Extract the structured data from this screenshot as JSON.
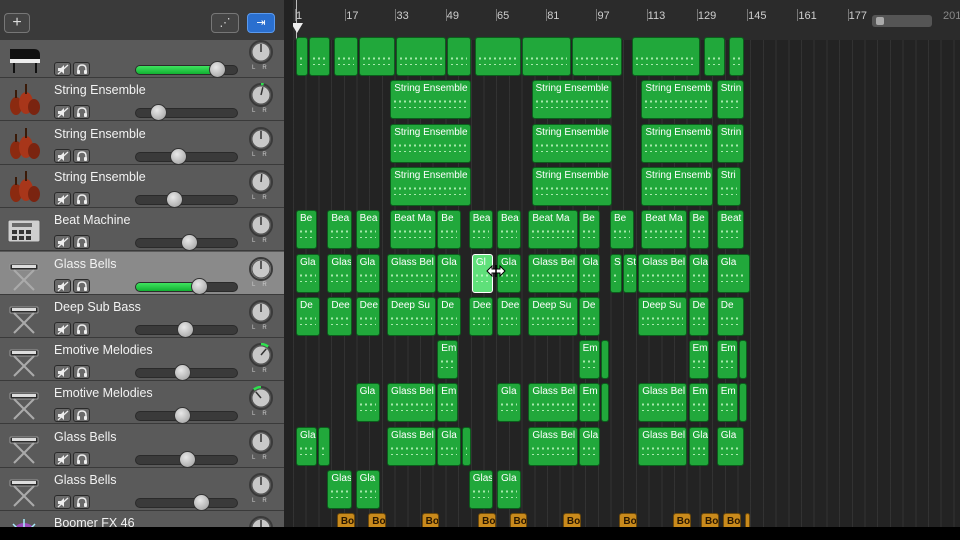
{
  "toolbar": {
    "add_track_label": "+",
    "automation_label": "⋰",
    "catch_label": "⇥"
  },
  "ruler": {
    "bars": [
      "1",
      "17",
      "33",
      "49",
      "65",
      "81",
      "97",
      "113",
      "129",
      "145",
      "161",
      "177"
    ],
    "right_partial": "201"
  },
  "tracks": [
    {
      "name": "",
      "icon": "grand-piano-icon",
      "volume": 0.8,
      "pan": 0.5,
      "green_volume": true,
      "selected": false
    },
    {
      "name": "String Ensemble",
      "icon": "string-ensemble-icon",
      "volume": 0.22,
      "pan": 0.55,
      "green_volume": false,
      "selected": false
    },
    {
      "name": "String Ensemble",
      "icon": "string-ensemble-icon",
      "volume": 0.42,
      "pan": 0.5,
      "green_volume": false,
      "selected": false
    },
    {
      "name": "String Ensemble",
      "icon": "string-ensemble-icon",
      "volume": 0.38,
      "pan": 0.52,
      "green_volume": false,
      "selected": false
    },
    {
      "name": "Beat Machine",
      "icon": "drum-machine-icon",
      "volume": 0.52,
      "pan": 0.5,
      "green_volume": false,
      "selected": false
    },
    {
      "name": "Glass Bells",
      "icon": "keyboard-stand-icon",
      "volume": 0.62,
      "pan": 0.5,
      "green_volume": true,
      "selected": true
    },
    {
      "name": "Deep Sub Bass",
      "icon": "keyboard-stand-icon",
      "volume": 0.49,
      "pan": 0.5,
      "green_volume": false,
      "selected": false
    },
    {
      "name": "Emotive Melodies",
      "icon": "keyboard-stand-icon",
      "volume": 0.46,
      "pan": 0.65,
      "green_volume": false,
      "selected": false
    },
    {
      "name": "Emotive Melodies",
      "icon": "keyboard-stand-icon",
      "volume": 0.46,
      "pan": 0.35,
      "green_volume": false,
      "selected": false
    },
    {
      "name": "Glass Bells",
      "icon": "keyboard-stand-icon",
      "volume": 0.5,
      "pan": 0.5,
      "green_volume": false,
      "selected": false
    },
    {
      "name": "Glass Bells",
      "icon": "keyboard-stand-icon",
      "volume": 0.64,
      "pan": 0.5,
      "green_volume": false,
      "selected": false
    },
    {
      "name": "Boomer FX 46",
      "icon": "fx-sparkle-icon",
      "volume": 0.35,
      "pan": 0.5,
      "green_volume": false,
      "selected": false
    }
  ],
  "regions": [
    [
      {
        "label": "",
        "s": 1,
        "e": 5,
        "c": "g"
      },
      {
        "label": "",
        "s": 5,
        "e": 12,
        "c": "g"
      },
      {
        "label": "",
        "s": 13,
        "e": 21,
        "c": "g"
      },
      {
        "label": "",
        "s": 21,
        "e": 33,
        "c": "g"
      },
      {
        "label": "",
        "s": 33,
        "e": 49,
        "c": "g"
      },
      {
        "label": "",
        "s": 49,
        "e": 57,
        "c": "g"
      },
      {
        "label": "",
        "s": 58,
        "e": 73,
        "c": "g"
      },
      {
        "label": "",
        "s": 73,
        "e": 89,
        "c": "g"
      },
      {
        "label": "",
        "s": 89,
        "e": 105,
        "c": "g"
      },
      {
        "label": "",
        "s": 108,
        "e": 130,
        "c": "g"
      },
      {
        "label": "",
        "s": 131,
        "e": 138,
        "c": "g"
      },
      {
        "label": "",
        "s": 139,
        "e": 144,
        "c": "g"
      }
    ],
    [
      {
        "label": "String Ensemble",
        "s": 31,
        "e": 57,
        "c": "g"
      },
      {
        "label": "String Ensemble",
        "s": 76,
        "e": 102,
        "c": "g"
      },
      {
        "label": "String Ensemb",
        "s": 111,
        "e": 134,
        "c": "g"
      },
      {
        "label": "Strin",
        "s": 135,
        "e": 144,
        "c": "g"
      }
    ],
    [
      {
        "label": "String Ensemble",
        "s": 31,
        "e": 57,
        "c": "g"
      },
      {
        "label": "String Ensemble",
        "s": 76,
        "e": 102,
        "c": "g"
      },
      {
        "label": "String Ensemb",
        "s": 111,
        "e": 134,
        "c": "g"
      },
      {
        "label": "Strin",
        "s": 135,
        "e": 144,
        "c": "g"
      }
    ],
    [
      {
        "label": "String Ensemble",
        "s": 31,
        "e": 57,
        "c": "g"
      },
      {
        "label": "String Ensemble",
        "s": 76,
        "e": 102,
        "c": "g"
      },
      {
        "label": "String Ensemb",
        "s": 111,
        "e": 134,
        "c": "g"
      },
      {
        "label": "Stri",
        "s": 135,
        "e": 143,
        "c": "g"
      }
    ],
    [
      {
        "label": "Be",
        "s": 1,
        "e": 8,
        "c": "g"
      },
      {
        "label": "Bea",
        "s": 11,
        "e": 19,
        "c": "g"
      },
      {
        "label": "Bea",
        "s": 20,
        "e": 28,
        "c": "g"
      },
      {
        "label": "Beat Ma",
        "s": 31,
        "e": 46,
        "c": "g"
      },
      {
        "label": "Be",
        "s": 46,
        "e": 54,
        "c": "g"
      },
      {
        "label": "Bea",
        "s": 56,
        "e": 64,
        "c": "g"
      },
      {
        "label": "Bea",
        "s": 65,
        "e": 73,
        "c": "g"
      },
      {
        "label": "Beat Ma",
        "s": 75,
        "e": 91,
        "c": "g"
      },
      {
        "label": "Be",
        "s": 91,
        "e": 98,
        "c": "g"
      },
      {
        "label": "Be",
        "s": 101,
        "e": 109,
        "c": "g"
      },
      {
        "label": "Beat Ma",
        "s": 111,
        "e": 126,
        "c": "g"
      },
      {
        "label": "Be",
        "s": 126,
        "e": 133,
        "c": "g"
      },
      {
        "label": "Beat",
        "s": 135,
        "e": 144,
        "c": "g"
      }
    ],
    [
      {
        "label": "Gla",
        "s": 1,
        "e": 9,
        "c": "g"
      },
      {
        "label": "Glas",
        "s": 11,
        "e": 19,
        "c": "g"
      },
      {
        "label": "Gla",
        "s": 20,
        "e": 28,
        "c": "g"
      },
      {
        "label": "Glass Bel",
        "s": 30,
        "e": 46,
        "c": "g"
      },
      {
        "label": "Gla",
        "s": 46,
        "e": 54,
        "c": "g"
      },
      {
        "label": "Gl",
        "s": 57,
        "e": 64,
        "c": "g",
        "sel": true
      },
      {
        "label": "Gla",
        "s": 65,
        "e": 73,
        "c": "g"
      },
      {
        "label": "Glass Bel",
        "s": 75,
        "e": 91,
        "c": "g"
      },
      {
        "label": "Gla",
        "s": 91,
        "e": 98,
        "c": "g"
      },
      {
        "label": "S",
        "s": 101,
        "e": 105,
        "c": "g"
      },
      {
        "label": "St",
        "s": 105,
        "e": 110,
        "c": "g"
      },
      {
        "label": "Glass Bel",
        "s": 110,
        "e": 126,
        "c": "g"
      },
      {
        "label": "Gla",
        "s": 126,
        "e": 133,
        "c": "g"
      },
      {
        "label": "Gla",
        "s": 135,
        "e": 146,
        "c": "g"
      }
    ],
    [
      {
        "label": "De",
        "s": 1,
        "e": 9,
        "c": "g"
      },
      {
        "label": "Dee",
        "s": 11,
        "e": 19,
        "c": "g"
      },
      {
        "label": "Dee",
        "s": 20,
        "e": 28,
        "c": "g"
      },
      {
        "label": "Deep Su",
        "s": 30,
        "e": 46,
        "c": "g"
      },
      {
        "label": "De",
        "s": 46,
        "e": 54,
        "c": "g"
      },
      {
        "label": "Dee",
        "s": 56,
        "e": 64,
        "c": "g"
      },
      {
        "label": "Dee",
        "s": 65,
        "e": 73,
        "c": "g"
      },
      {
        "label": "Deep Su",
        "s": 75,
        "e": 91,
        "c": "g"
      },
      {
        "label": "De",
        "s": 91,
        "e": 98,
        "c": "g"
      },
      {
        "label": "Deep Su",
        "s": 110,
        "e": 126,
        "c": "g"
      },
      {
        "label": "De",
        "s": 126,
        "e": 133,
        "c": "g"
      },
      {
        "label": "De",
        "s": 135,
        "e": 144,
        "c": "g"
      }
    ],
    [
      {
        "label": "Em",
        "s": 46,
        "e": 53,
        "c": "g"
      },
      {
        "label": "Em",
        "s": 91,
        "e": 98,
        "c": "g"
      },
      {
        "label": "",
        "s": 98,
        "e": 101,
        "c": "g"
      },
      {
        "label": "Em",
        "s": 126,
        "e": 133,
        "c": "g"
      },
      {
        "label": "Em",
        "s": 135,
        "e": 142,
        "c": "g"
      },
      {
        "label": "",
        "s": 142,
        "e": 145,
        "c": "g"
      }
    ],
    [
      {
        "label": "Gla",
        "s": 20,
        "e": 28,
        "c": "g"
      },
      {
        "label": "Glass Bel",
        "s": 30,
        "e": 46,
        "c": "g"
      },
      {
        "label": "Em",
        "s": 46,
        "e": 53,
        "c": "g"
      },
      {
        "label": "Gla",
        "s": 65,
        "e": 73,
        "c": "g"
      },
      {
        "label": "Glass Bel",
        "s": 75,
        "e": 91,
        "c": "g"
      },
      {
        "label": "Em",
        "s": 91,
        "e": 98,
        "c": "g"
      },
      {
        "label": "",
        "s": 98,
        "e": 101,
        "c": "g"
      },
      {
        "label": "Glass Bel",
        "s": 110,
        "e": 126,
        "c": "g"
      },
      {
        "label": "Em",
        "s": 126,
        "e": 133,
        "c": "g"
      },
      {
        "label": "Em",
        "s": 135,
        "e": 142,
        "c": "g"
      },
      {
        "label": "",
        "s": 142,
        "e": 145,
        "c": "g"
      }
    ],
    [
      {
        "label": "Gla",
        "s": 1,
        "e": 8,
        "c": "g"
      },
      {
        "label": "",
        "s": 8,
        "e": 12,
        "c": "g"
      },
      {
        "label": "Glass Bel",
        "s": 30,
        "e": 46,
        "c": "g"
      },
      {
        "label": "Gla",
        "s": 46,
        "e": 54,
        "c": "g"
      },
      {
        "label": "",
        "s": 54,
        "e": 57,
        "c": "g"
      },
      {
        "label": "Glass Bel",
        "s": 75,
        "e": 91,
        "c": "g"
      },
      {
        "label": "Gla",
        "s": 91,
        "e": 98,
        "c": "g"
      },
      {
        "label": "Glass Bel",
        "s": 110,
        "e": 126,
        "c": "g"
      },
      {
        "label": "Gla",
        "s": 126,
        "e": 133,
        "c": "g"
      },
      {
        "label": "Gla",
        "s": 135,
        "e": 144,
        "c": "g"
      }
    ],
    [
      {
        "label": "Glas",
        "s": 11,
        "e": 19,
        "c": "g"
      },
      {
        "label": "Gla",
        "s": 20,
        "e": 28,
        "c": "g"
      },
      {
        "label": "Glas",
        "s": 56,
        "e": 64,
        "c": "g"
      },
      {
        "label": "Gla",
        "s": 65,
        "e": 73,
        "c": "g"
      }
    ],
    [
      {
        "label": "Bo",
        "s": 14,
        "e": 20,
        "c": "o"
      },
      {
        "label": "Bo",
        "s": 24,
        "e": 30,
        "c": "o"
      },
      {
        "label": "Bo",
        "s": 41,
        "e": 47,
        "c": "o"
      },
      {
        "label": "Bo",
        "s": 59,
        "e": 65,
        "c": "o"
      },
      {
        "label": "Bo",
        "s": 69,
        "e": 75,
        "c": "o"
      },
      {
        "label": "Bo",
        "s": 86,
        "e": 92,
        "c": "o"
      },
      {
        "label": "Bo",
        "s": 104,
        "e": 110,
        "c": "o"
      },
      {
        "label": "Bo",
        "s": 121,
        "e": 127,
        "c": "o"
      },
      {
        "label": "Bo",
        "s": 130,
        "e": 136,
        "c": "o"
      },
      {
        "label": "Bo",
        "s": 137,
        "e": 143,
        "c": "o"
      },
      {
        "label": "",
        "s": 144,
        "e": 146,
        "c": "o"
      }
    ]
  ],
  "colors": {
    "region_green": "#21a83b",
    "region_orange": "#c98a1c",
    "catch_blue": "#2a6fcf",
    "volume_green": "#2ed04e"
  }
}
